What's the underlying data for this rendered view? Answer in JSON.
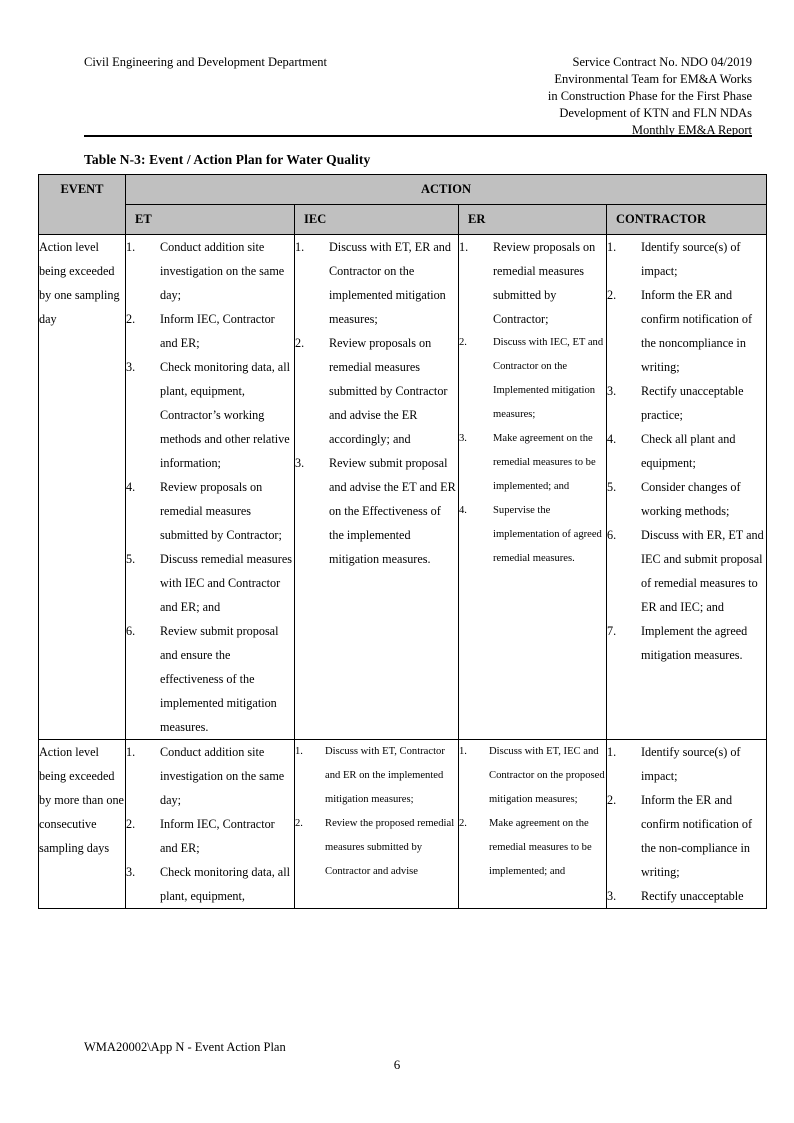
{
  "header": {
    "left": "Civil Engineering and Development Department",
    "right_lines": [
      "Service Contract No. NDO 04/2019",
      "Environmental Team for EM&A Works",
      "in Construction Phase for the First Phase",
      "Development of KTN and FLN NDAs",
      "Monthly EM&A Report"
    ]
  },
  "table_title": "Table N-3: Event / Action Plan for Water Quality",
  "table": {
    "header": {
      "event": "EVENT",
      "action": "ACTION",
      "et": "ET",
      "iec": "IEC",
      "er": "ER",
      "contractor": "CONTRACTOR"
    },
    "rows": [
      {
        "event": "Action level being exceeded by one sampling day",
        "et": [
          "Conduct addition site investigation on the same day;",
          "Inform IEC, Contractor and ER;",
          "Check monitoring data, all plant, equipment, Contractor’s working methods and other relative information;",
          "Review proposals on remedial measures submitted by Contractor;",
          "Discuss remedial measures with IEC and Contractor and ER; and",
          "Review submit proposal and ensure the effectiveness of the implemented mitigation measures."
        ],
        "iec": [
          "Discuss with ET, ER and Contractor on the implemented mitigation measures;",
          "Review proposals on remedial measures submitted by Contractor and advise the ER accordingly; and",
          "Review submit proposal and advise the ET and ER on the Effectiveness of the implemented mitigation measures."
        ],
        "er": [
          "Review proposals on remedial measures submitted by Contractor;",
          "Discuss with IEC, ET and Contractor on the Implemented mitigation measures;",
          "Make agreement on the remedial measures to be implemented; and",
          "Supervise the implementation of agreed remedial measures."
        ],
        "er_small_from": 1,
        "contractor": [
          "Identify source(s) of impact;",
          "Inform the ER and confirm notification of the noncompliance in writing;",
          "Rectify unacceptable practice;",
          "Check all plant and equipment;",
          "Consider changes of working methods;",
          "Discuss with ER, ET and IEC and submit proposal of remedial measures to ER and IEC; and",
          "Implement the agreed mitigation measures."
        ]
      },
      {
        "event": "Action level being exceeded by more than one consecutive sampling days",
        "et": [
          "Conduct addition site investigation on the same day;",
          "Inform IEC, Contractor and ER;",
          "Check monitoring data, all plant, equipment,"
        ],
        "iec": [
          "Discuss with ET, Contractor and ER on the implemented mitigation measures;",
          "Review the proposed remedial measures submitted by Contractor and advise"
        ],
        "er": [
          "Discuss with ET, IEC and Contractor on the proposed mitigation measures;",
          "Make agreement on the remedial measures to be implemented; and"
        ],
        "er_small_from": 0,
        "iec_small_from": 0,
        "contractor": [
          "Identify source(s) of impact;",
          "Inform the ER and confirm notification of the non-compliance in writing;",
          "Rectify unacceptable"
        ]
      }
    ]
  },
  "footer": {
    "left": "WMA20002\\App N - Event Action Plan",
    "page_number": "6"
  }
}
